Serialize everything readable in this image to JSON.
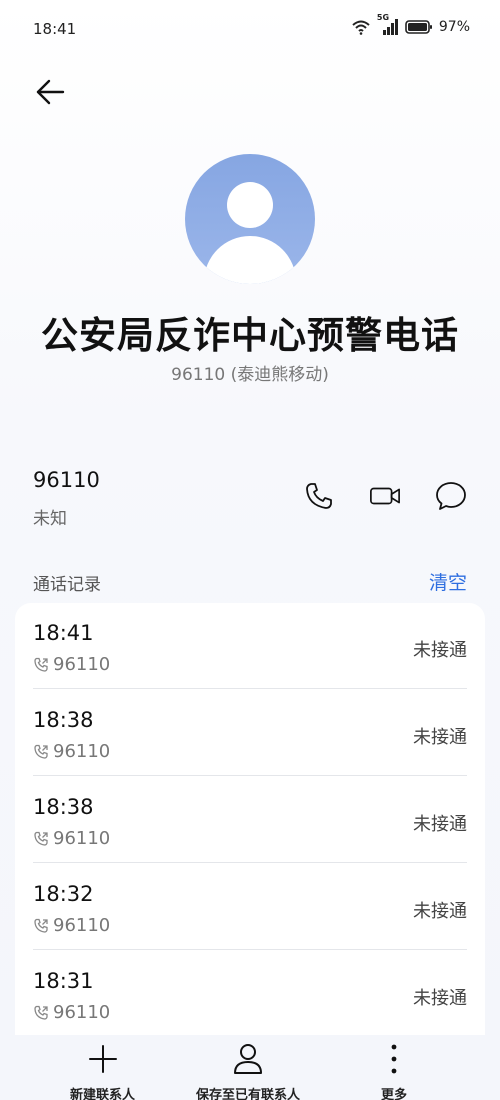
{
  "status_bar": {
    "time": "18:41",
    "battery_percent": "97%",
    "network_label": "5G",
    "icons": [
      "wifi-icon",
      "signal-icon",
      "battery-icon"
    ]
  },
  "contact": {
    "name": "公安局反诈中心预警电话",
    "subtitle": "96110 (泰迪熊移动)"
  },
  "number_row": {
    "number": "96110",
    "label": "未知",
    "actions": [
      "phone-icon",
      "video-call-icon",
      "message-icon"
    ]
  },
  "call_log": {
    "title": "通话记录",
    "clear_label": "清空",
    "items": [
      {
        "time": "18:41",
        "number": "96110",
        "status": "未接通"
      },
      {
        "time": "18:38",
        "number": "96110",
        "status": "未接通"
      },
      {
        "time": "18:38",
        "number": "96110",
        "status": "未接通"
      },
      {
        "time": "18:32",
        "number": "96110",
        "status": "未接通"
      },
      {
        "time": "18:31",
        "number": "96110",
        "status": "未接通"
      }
    ]
  },
  "bottom_bar": {
    "new_contact": "新建联系人",
    "save_existing": "保存至已有联系人",
    "more": "更多"
  },
  "colors": {
    "accent": "#2f6fe0",
    "avatar": "#8faae5"
  }
}
